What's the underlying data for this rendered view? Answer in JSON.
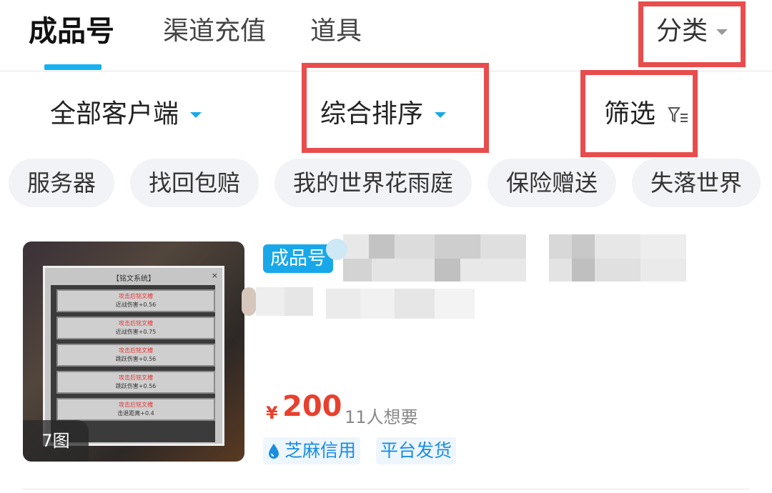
{
  "tabs": {
    "active": "成品号",
    "recharge": "渠道充值",
    "items": "道具"
  },
  "category": "分类",
  "sort": {
    "client": "全部客户端",
    "general": "综合排序",
    "filter": "筛选"
  },
  "chips": [
    "服务器",
    "找回包赔",
    "我的世界花雨庭",
    "保险赠送",
    "失落世界"
  ],
  "listing": {
    "badge": "成品号",
    "currency": "¥",
    "price": "200",
    "wanted": "11人想要",
    "image_count": "7图",
    "thumb_title": "【铭文系统】",
    "thumb_close": "×",
    "thumb_slots": [
      {
        "name": "攻击后铭文槽",
        "stat": "近战伤害+0.56"
      },
      {
        "name": "攻击后铭文槽",
        "stat": "近战伤害+0.75"
      },
      {
        "name": "攻击后铭文槽",
        "stat": "跳跃伤害+0.56"
      },
      {
        "name": "攻击后铭文槽",
        "stat": "跳跃伤害+0.56"
      },
      {
        "name": "攻击后铭文槽",
        "stat": "击退距离+0.4"
      }
    ],
    "tags": [
      "芝麻信用",
      "平台发货"
    ]
  },
  "colors": {
    "accent": "#18a8ea",
    "price": "#e8402e",
    "annotation": "#e84c4c"
  }
}
